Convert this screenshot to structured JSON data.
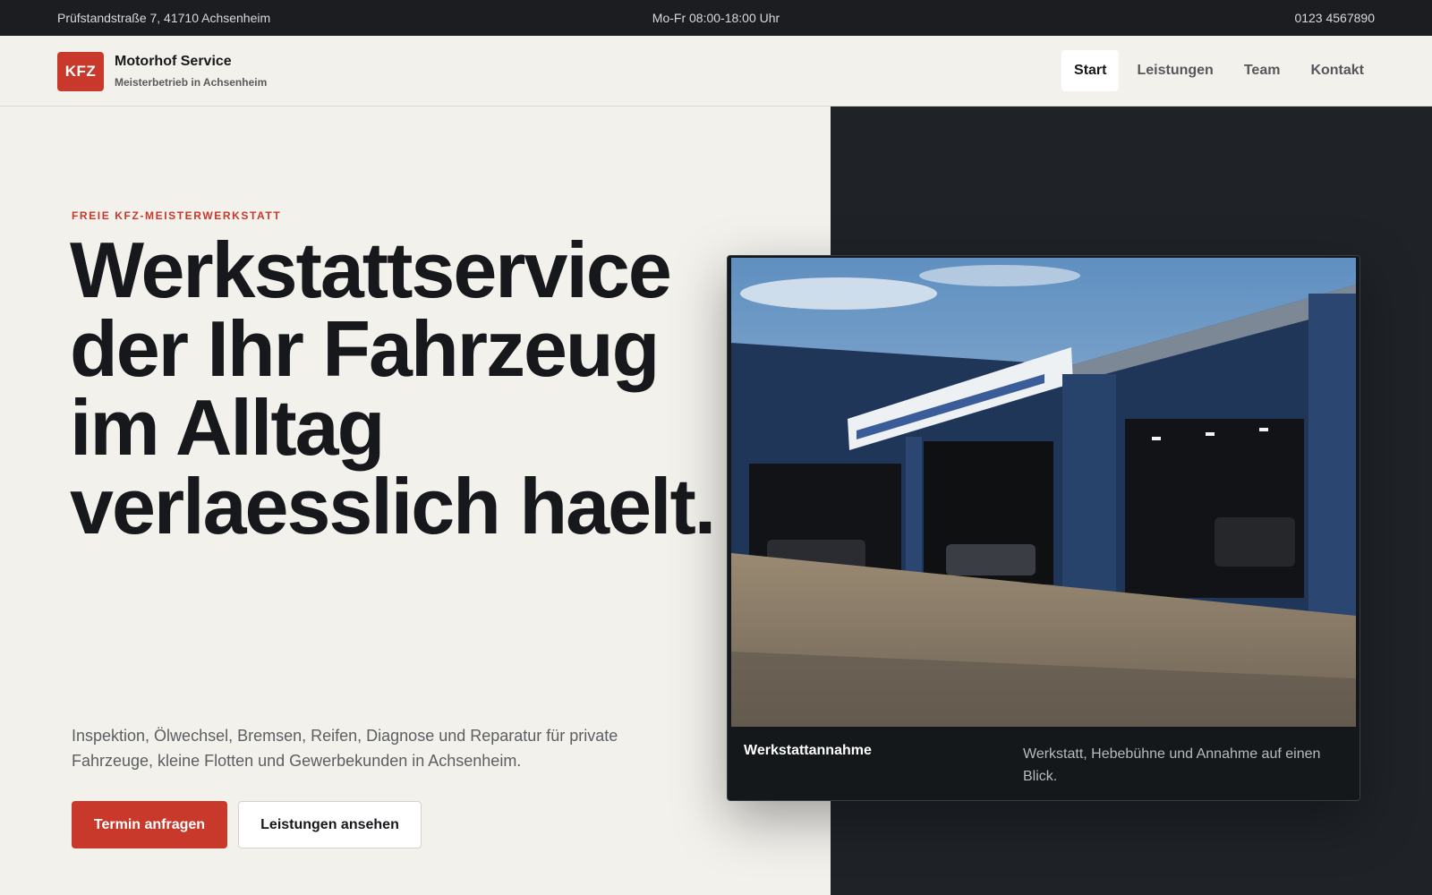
{
  "topbar": {
    "address": "Prüfstandstraße 7, 41710 Achsenheim",
    "hours": "Mo-Fr 08:00-18:00 Uhr",
    "phone": "0123 4567890"
  },
  "brand": {
    "logo_text": "KFZ",
    "name": "Motorhof Service",
    "tagline": "Meisterbetrieb in Achsenheim",
    "accent_color": "#c8382b"
  },
  "nav": {
    "items": [
      "Start",
      "Leistungen",
      "Team",
      "Kontakt"
    ],
    "active": "Start"
  },
  "hero": {
    "eyebrow": "FREIE KFZ-MEISTERWERKSTATT",
    "headline": "Werkstattservice der Ihr Fahrzeug im Alltag verlaesslich haelt.",
    "lead": "Inspektion, Ölwechsel, Bremsen, Reifen, Diagnose und Reparatur für private Fahrzeuge, kleine Flotten und Gewerbekunden in Achsenheim.",
    "primary_cta": "Termin anfragen",
    "secondary_cta": "Leistungen ansehen"
  },
  "feature_card": {
    "title": "Werkstattannahme",
    "text": "Werkstatt, Hebebühne und Annahme auf einen Blick."
  }
}
